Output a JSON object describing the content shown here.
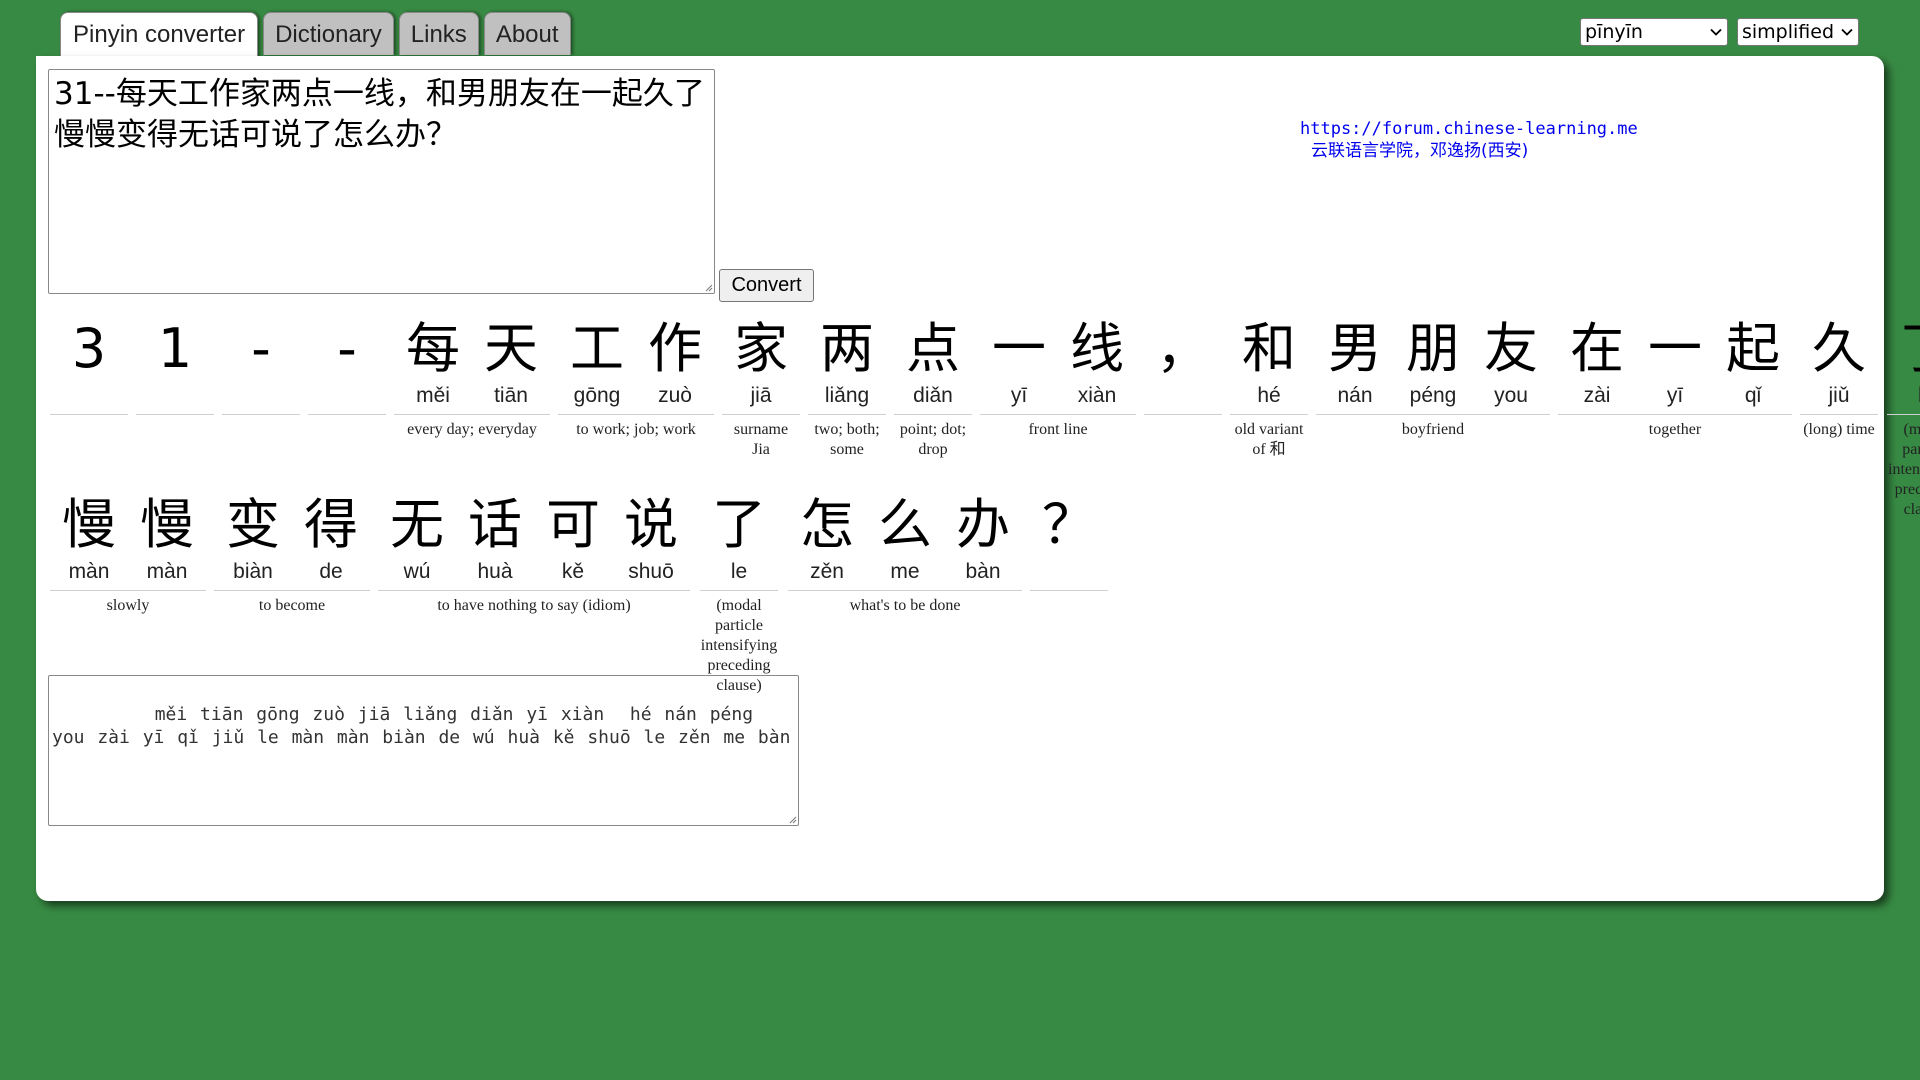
{
  "tabs": [
    {
      "label": "Pinyin converter",
      "active": true
    },
    {
      "label": "Dictionary",
      "active": false
    },
    {
      "label": "Links",
      "active": false
    },
    {
      "label": "About",
      "active": false
    }
  ],
  "selects": {
    "pinyin_style": "pīnyīn",
    "script": "simplified"
  },
  "input": {
    "text": "31--每天工作家两点一线，和男朋友在一起久了慢慢变得无话可说了怎么办？"
  },
  "convert_label": "Convert",
  "credit": {
    "url": "https://forum.chinese-learning.me",
    "school": "云联语言学院，邓逸扬(西安)"
  },
  "words_row1": [
    {
      "chars": [
        {
          "han": "3",
          "py": ""
        }
      ],
      "gloss": ""
    },
    {
      "chars": [
        {
          "han": "1",
          "py": ""
        }
      ],
      "gloss": ""
    },
    {
      "chars": [
        {
          "han": "-",
          "py": ""
        }
      ],
      "gloss": ""
    },
    {
      "chars": [
        {
          "han": "-",
          "py": ""
        }
      ],
      "gloss": ""
    },
    {
      "chars": [
        {
          "han": "每",
          "py": "měi"
        },
        {
          "han": "天",
          "py": "tiān"
        }
      ],
      "gloss": "every day; everyday"
    },
    {
      "chars": [
        {
          "han": "工",
          "py": "gōng"
        },
        {
          "han": "作",
          "py": "zuò"
        }
      ],
      "gloss": "to work; job; work"
    },
    {
      "chars": [
        {
          "han": "家",
          "py": "jiā"
        }
      ],
      "gloss": "surname Jia"
    },
    {
      "chars": [
        {
          "han": "两",
          "py": "liǎng"
        }
      ],
      "gloss": "two; both; some"
    },
    {
      "chars": [
        {
          "han": "点",
          "py": "diǎn"
        }
      ],
      "gloss": "point; dot; drop"
    },
    {
      "chars": [
        {
          "han": "一",
          "py": "yī"
        },
        {
          "han": "线",
          "py": "xiàn"
        }
      ],
      "gloss": "front line"
    },
    {
      "chars": [
        {
          "han": "，",
          "py": ""
        }
      ],
      "gloss": ""
    },
    {
      "chars": [
        {
          "han": "和",
          "py": "hé"
        }
      ],
      "gloss": "old variant of 和"
    },
    {
      "chars": [
        {
          "han": "男",
          "py": "nán"
        },
        {
          "han": "朋",
          "py": "péng"
        },
        {
          "han": "友",
          "py": "you"
        }
      ],
      "gloss": "boyfriend"
    },
    {
      "chars": [
        {
          "han": "在",
          "py": "zài"
        },
        {
          "han": "一",
          "py": "yī"
        },
        {
          "han": "起",
          "py": "qǐ"
        }
      ],
      "gloss": "together"
    },
    {
      "chars": [
        {
          "han": "久",
          "py": "jiǔ"
        }
      ],
      "gloss": "(long) time"
    },
    {
      "chars": [
        {
          "han": "了",
          "py": "le"
        }
      ],
      "gloss": "(modal particle intensifying preceding clause)"
    }
  ],
  "words_row2": [
    {
      "chars": [
        {
          "han": "慢",
          "py": "màn"
        },
        {
          "han": "慢",
          "py": "màn"
        }
      ],
      "gloss": "slowly"
    },
    {
      "chars": [
        {
          "han": "变",
          "py": "biàn"
        },
        {
          "han": "得",
          "py": "de"
        }
      ],
      "gloss": "to become"
    },
    {
      "chars": [
        {
          "han": "无",
          "py": "wú"
        },
        {
          "han": "话",
          "py": "huà"
        },
        {
          "han": "可",
          "py": "kě"
        },
        {
          "han": "说",
          "py": "shuō"
        }
      ],
      "gloss": "to have nothing to say (idiom)"
    },
    {
      "chars": [
        {
          "han": "了",
          "py": "le"
        }
      ],
      "gloss": "(modal particle intensifying preceding clause)"
    },
    {
      "chars": [
        {
          "han": "怎",
          "py": "zěn"
        },
        {
          "han": "么",
          "py": "me"
        },
        {
          "han": "办",
          "py": "bàn"
        }
      ],
      "gloss": "what's to be done"
    },
    {
      "chars": [
        {
          "han": "？",
          "py": ""
        }
      ],
      "gloss": ""
    }
  ],
  "output": {
    "text": "    měi tiān gōng zuò jiā liǎng diǎn yī xiàn  hé nán péng you zài yī qǐ jiǔ le màn màn biàn de wú huà kě shuō le zěn me bàn"
  }
}
